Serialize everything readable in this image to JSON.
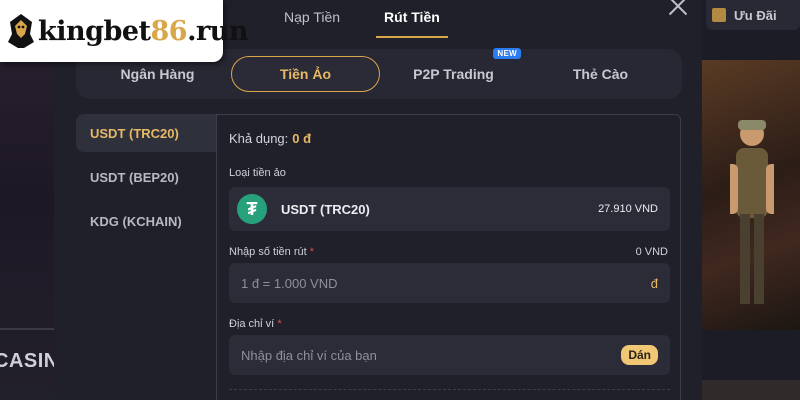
{
  "logo": {
    "text_main": "kingbet",
    "text_accent": "86",
    "text_tail": ".run"
  },
  "background": {
    "left_label": "CASIN",
    "right_button": "Ưu Đãi"
  },
  "modal": {
    "top_tabs": [
      {
        "label": "Nạp Tiền",
        "active": false
      },
      {
        "label": "Rút Tiền",
        "active": true
      }
    ],
    "sub_tabs": [
      {
        "label": "Ngân Hàng",
        "active": false
      },
      {
        "label": "Tiền Ảo",
        "active": true
      },
      {
        "label": "P2P Trading",
        "active": false,
        "badge": "NEW"
      },
      {
        "label": "Thẻ Cào",
        "active": false
      }
    ],
    "sidebar": [
      {
        "label": "USDT (TRC20)",
        "active": true
      },
      {
        "label": "USDT (BEP20)",
        "active": false
      },
      {
        "label": "KDG (KCHAIN)",
        "active": false
      }
    ],
    "panel": {
      "balance_label": "Khả dụng:",
      "balance_value": "0 đ",
      "crypto_type_label": "Loại tiền ảo",
      "selected_coin": {
        "symbol": "₮",
        "name": "USDT (TRC20)",
        "rate": "27.910 VND"
      },
      "amount_label": "Nhập số tiền rút",
      "required_mark": "*",
      "amount_converted": "0 VND",
      "amount_placeholder": "1 đ = 1.000 VND",
      "amount_suffix": "đ",
      "wallet_label": "Địa chỉ ví",
      "wallet_placeholder": "Nhập địa chỉ ví của bạn",
      "paste_label": "Dán"
    }
  },
  "colors": {
    "accent": "#d9a64a",
    "tether": "#26a17b",
    "new_badge": "#2a7cf0",
    "required": "#e54b4b"
  }
}
